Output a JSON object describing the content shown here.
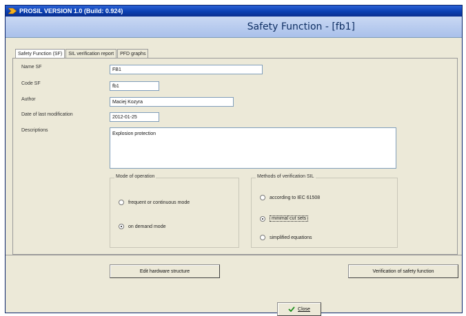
{
  "window": {
    "title": "PROSIL VERSION 1.0 (Build: 0.924)",
    "header": "Safety Function - [fb1]"
  },
  "tabs": [
    {
      "label": "Safety Function (SF)",
      "active": true
    },
    {
      "label": "SIL verification report",
      "active": false
    },
    {
      "label": "PFD graphs",
      "active": false
    }
  ],
  "form": {
    "name_label": "Name SF",
    "name_value": "FB1",
    "code_label": "Code SF",
    "code_value": "fb1",
    "author_label": "Author",
    "author_value": "Maciej Kozyra",
    "date_label": "Date of last modification",
    "date_value": "2012-01-25",
    "desc_label": "Descriptions",
    "desc_value": "Explosion protection"
  },
  "mode_group": {
    "title": "Mode of operation",
    "options": [
      {
        "label": "frequent or continuous mode",
        "selected": false
      },
      {
        "label": "on demand mode",
        "selected": true
      }
    ]
  },
  "method_group": {
    "title": "Methods of verification SIL",
    "options": [
      {
        "label": "according to IEC 61508",
        "selected": false
      },
      {
        "label": "minimal cut sets",
        "selected": true
      },
      {
        "label": "simplified equations",
        "selected": false
      }
    ]
  },
  "buttons": {
    "edit_hw": "Edit hardware structure",
    "verify": "Verification of safety function",
    "close": "Close"
  },
  "colors": {
    "titlebar": "#0a3fb2",
    "header_band": "#a9c0ea",
    "header_text": "#0f2f63",
    "window_bg": "#ece9d8"
  }
}
